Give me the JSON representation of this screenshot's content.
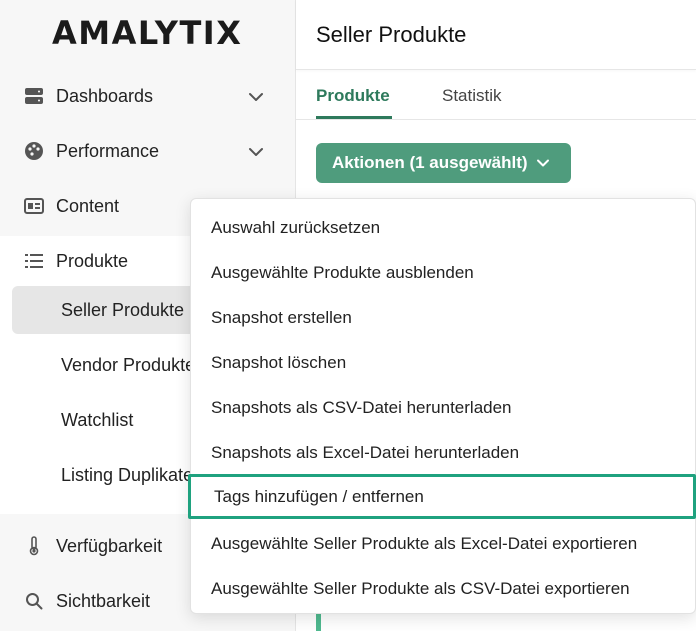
{
  "brand": {
    "logo": "AMALYTIX"
  },
  "sidebar": {
    "items": [
      {
        "label": "Dashboards",
        "icon": "server-icon",
        "expandable": true
      },
      {
        "label": "Performance",
        "icon": "palette-icon",
        "expandable": true
      },
      {
        "label": "Content",
        "icon": "id-card-icon",
        "expandable": false
      },
      {
        "label": "Produkte",
        "icon": "list-icon",
        "expandable": false
      },
      {
        "label": "Verfügbarkeit",
        "icon": "thermometer-icon",
        "expandable": false
      },
      {
        "label": "Sichtbarkeit",
        "icon": "search-icon",
        "expandable": false
      }
    ],
    "produkte_sub": [
      {
        "label": "Seller Produkte",
        "active": true
      },
      {
        "label": "Vendor Produkte",
        "active": false
      },
      {
        "label": "Watchlist",
        "active": false
      },
      {
        "label": "Listing Duplikate",
        "active": false
      }
    ]
  },
  "header": {
    "title": "Seller Produkte"
  },
  "tabs": [
    {
      "label": "Produkte",
      "active": true
    },
    {
      "label": "Statistik",
      "active": false
    }
  ],
  "actions": {
    "label": "Aktionen (1 ausgewählt)"
  },
  "dropdown": {
    "items": [
      {
        "label": "Auswahl zurücksetzen"
      },
      {
        "label": "Ausgewählte Produkte ausblenden"
      },
      {
        "label": "Snapshot erstellen"
      },
      {
        "label": "Snapshot löschen"
      },
      {
        "label": "Snapshots als CSV-Datei herunterladen"
      },
      {
        "label": "Snapshots als Excel-Datei herunterladen"
      },
      {
        "label": "Tags hinzufügen / entfernen",
        "highlighted": true
      },
      {
        "label": "Ausgewählte Seller Produkte als Excel-Datei exportieren"
      },
      {
        "label": "Ausgewählte Seller Produkte als CSV-Datei exportieren"
      }
    ]
  },
  "colors": {
    "accent": "#2e7a5c",
    "button": "#4f9c7d",
    "highlight": "#1fa27f"
  }
}
